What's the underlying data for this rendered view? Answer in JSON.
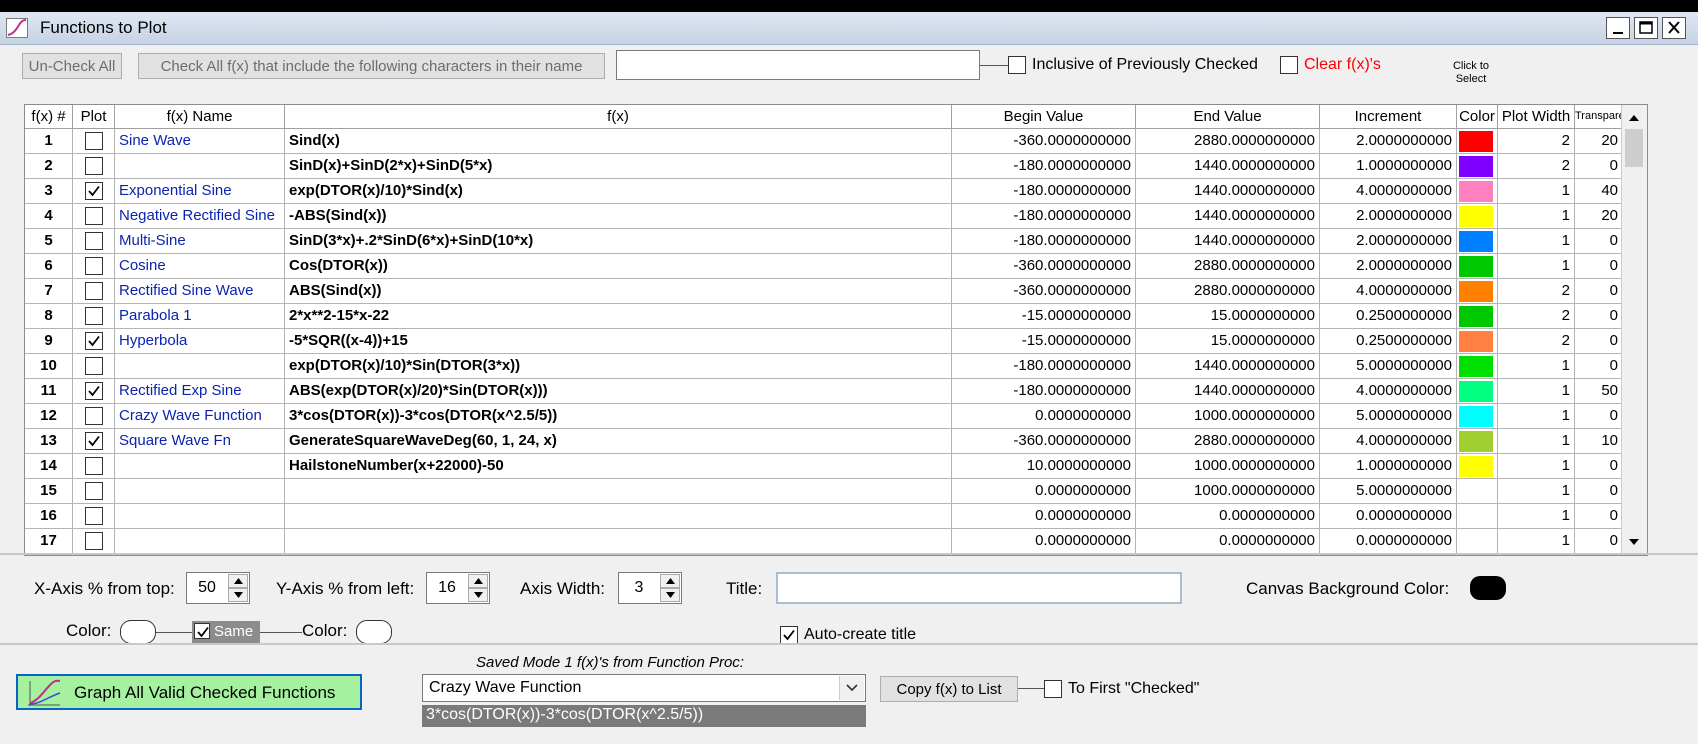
{
  "window": {
    "title": "Functions to Plot",
    "buttons": [
      "minimize",
      "maximize",
      "close"
    ]
  },
  "toolbar": {
    "uncheck_all_label": "Un-Check All",
    "check_all_label": "Check All f(x) that include the following characters in their name",
    "filter_value": "",
    "inclusive_label": "Inclusive of Previously Checked",
    "inclusive_checked": false,
    "clear_label": "Clear f(x)'s",
    "clear_checked": false,
    "clear_color": "#ff0000",
    "click_to_select": "Click to Select"
  },
  "grid": {
    "headers": [
      "f(x) #",
      "Plot",
      "f(x) Name",
      "f(x)",
      "Begin Value",
      "End Value",
      "Increment",
      "Color",
      "Plot Width",
      "Transparency"
    ],
    "rows": [
      {
        "num": "1",
        "plot": false,
        "name": "Sine Wave",
        "fx": "Sind(x)",
        "begin": "-360.0000000000",
        "end": "2880.0000000000",
        "inc": "2.0000000000",
        "color": "#ff0000",
        "width": "2",
        "trans": "20"
      },
      {
        "num": "2",
        "plot": false,
        "name": "",
        "fx": "SinD(x)+SinD(2*x)+SinD(5*x)",
        "begin": "-180.0000000000",
        "end": "1440.0000000000",
        "inc": "1.0000000000",
        "color": "#8000ff",
        "width": "2",
        "trans": "0"
      },
      {
        "num": "3",
        "plot": true,
        "name": "Exponential Sine",
        "fx": "exp(DTOR(x)/10)*Sind(x)",
        "begin": "-180.0000000000",
        "end": "1440.0000000000",
        "inc": "4.0000000000",
        "color": "#ff80c0",
        "width": "1",
        "trans": "40"
      },
      {
        "num": "4",
        "plot": false,
        "name": "Negative Rectified Sine",
        "fx": "-ABS(Sind(x))",
        "begin": "-180.0000000000",
        "end": "1440.0000000000",
        "inc": "2.0000000000",
        "color": "#ffff00",
        "width": "1",
        "trans": "20"
      },
      {
        "num": "5",
        "plot": false,
        "name": "Multi-Sine",
        "fx": "SinD(3*x)+.2*SinD(6*x)+SinD(10*x)",
        "begin": "-180.0000000000",
        "end": "1440.0000000000",
        "inc": "2.0000000000",
        "color": "#0080ff",
        "width": "1",
        "trans": "0"
      },
      {
        "num": "6",
        "plot": false,
        "name": "Cosine",
        "fx": "Cos(DTOR(x))",
        "begin": "-360.0000000000",
        "end": "2880.0000000000",
        "inc": "2.0000000000",
        "color": "#00c800",
        "width": "1",
        "trans": "0"
      },
      {
        "num": "7",
        "plot": false,
        "name": "Rectified Sine Wave",
        "fx": "ABS(Sind(x))",
        "begin": "-360.0000000000",
        "end": "2880.0000000000",
        "inc": "4.0000000000",
        "color": "#ff8000",
        "width": "2",
        "trans": "0"
      },
      {
        "num": "8",
        "plot": false,
        "name": "Parabola 1",
        "fx": "2*x**2-15*x-22",
        "begin": "-15.0000000000",
        "end": "15.0000000000",
        "inc": "0.2500000000",
        "color": "#00c800",
        "width": "2",
        "trans": "0"
      },
      {
        "num": "9",
        "plot": true,
        "name": "Hyperbola",
        "fx": "-5*SQR((x-4))+15",
        "begin": "-15.0000000000",
        "end": "15.0000000000",
        "inc": "0.2500000000",
        "color": "#ff8040",
        "width": "2",
        "trans": "0"
      },
      {
        "num": "10",
        "plot": false,
        "name": "",
        "fx": "exp(DTOR(x)/10)*Sin(DTOR(3*x))",
        "begin": "-180.0000000000",
        "end": "1440.0000000000",
        "inc": "5.0000000000",
        "color": "#00e000",
        "width": "1",
        "trans": "0"
      },
      {
        "num": "11",
        "plot": true,
        "name": "Rectified Exp Sine",
        "fx": "ABS(exp(DTOR(x)/20)*Sin(DTOR(x)))",
        "begin": "-180.0000000000",
        "end": "1440.0000000000",
        "inc": "4.0000000000",
        "color": "#00ff80",
        "width": "1",
        "trans": "50"
      },
      {
        "num": "12",
        "plot": false,
        "name": "Crazy Wave Function",
        "fx": "3*cos(DTOR(x))-3*cos(DTOR(x^2.5/5))",
        "begin": "0.0000000000",
        "end": "1000.0000000000",
        "inc": "5.0000000000",
        "color": "#00ffff",
        "width": "1",
        "trans": "0"
      },
      {
        "num": "13",
        "plot": true,
        "name": "Square Wave Fn",
        "fx": "GenerateSquareWaveDeg(60, 1, 24, x)",
        "begin": "-360.0000000000",
        "end": "2880.0000000000",
        "inc": "4.0000000000",
        "color": "#a0d030",
        "width": "1",
        "trans": "10"
      },
      {
        "num": "14",
        "plot": false,
        "name": "",
        "fx": "HailstoneNumber(x+22000)-50",
        "begin": "10.0000000000",
        "end": "1000.0000000000",
        "inc": "1.0000000000",
        "color": "#ffff00",
        "width": "1",
        "trans": "0"
      },
      {
        "num": "15",
        "plot": false,
        "name": "",
        "fx": "",
        "begin": "0.0000000000",
        "end": "1000.0000000000",
        "inc": "5.0000000000",
        "color": "",
        "width": "1",
        "trans": "0"
      },
      {
        "num": "16",
        "plot": false,
        "name": "",
        "fx": "",
        "begin": "0.0000000000",
        "end": "0.0000000000",
        "inc": "0.0000000000",
        "color": "",
        "width": "1",
        "trans": "0"
      },
      {
        "num": "17",
        "plot": false,
        "name": "",
        "fx": "",
        "begin": "0.0000000000",
        "end": "0.0000000000",
        "inc": "0.0000000000",
        "color": "",
        "width": "1",
        "trans": "0"
      }
    ]
  },
  "axis": {
    "x_label": "X-Axis % from top:",
    "x_value": "50",
    "y_label": "Y-Axis % from left:",
    "y_value": "16",
    "width_label": "Axis Width:",
    "width_value": "3",
    "title_label": "Title:",
    "title_value": "",
    "canvas_bg_label": "Canvas Background Color:",
    "canvas_bg_color": "#000000",
    "color_label_left": "Color:",
    "same_label": "Same",
    "same_checked": true,
    "color_label_right": "Color:",
    "auto_title_label": "Auto-create title",
    "auto_title_checked": true
  },
  "bottom": {
    "graph_button_label": "Graph All Valid Checked Functions",
    "saved_label": "Saved Mode 1 f(x)'s from Function Proc:",
    "saved_selected": "Crazy Wave Function",
    "saved_formula": "3*cos(DTOR(x))-3*cos(DTOR(x^2.5/5))",
    "copy_label": "Copy f(x) to List",
    "to_first_label": "To First \"Checked\"",
    "to_first_checked": false
  }
}
